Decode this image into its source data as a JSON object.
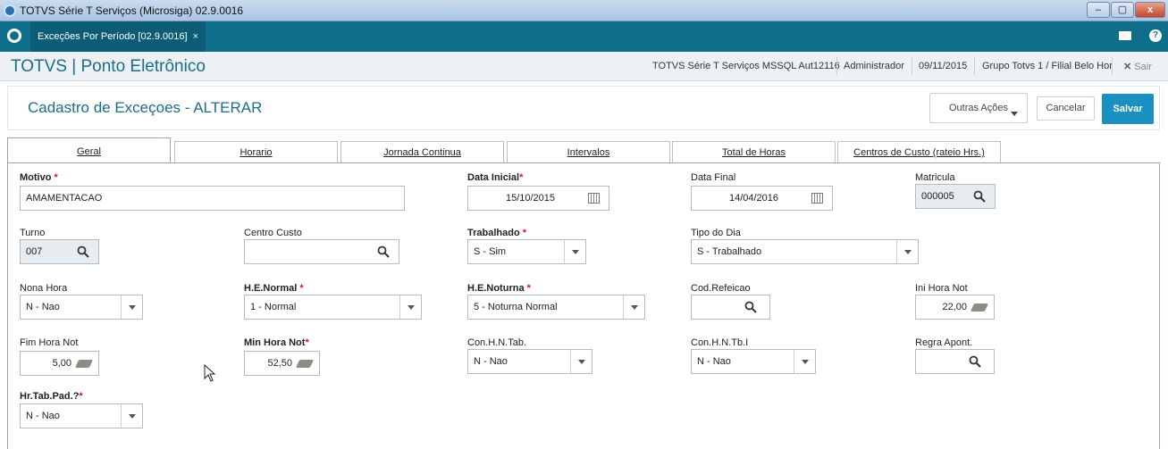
{
  "window": {
    "title": "TOTVS Série T Serviços (Microsiga) 02.9.0016"
  },
  "app_tab": {
    "label": "Exceções Por Período [02.9.0016]",
    "close": "×"
  },
  "header": {
    "module_title": "TOTVS | Ponto Eletrônico",
    "environment": "TOTVS Série T Serviços MSSQL Aut12116",
    "user": "Administrador",
    "date": "09/11/2015",
    "group": "Grupo Totvs 1 / Filial Belo Hor",
    "exit_label": "Sair"
  },
  "form": {
    "title": "Cadastro de Exceçoes - ALTERAR",
    "other_actions_label": "Outras Ações",
    "cancel_label": "Cancelar",
    "save_label": "Salvar"
  },
  "tabs": [
    {
      "label": "Geral"
    },
    {
      "label": "Horario"
    },
    {
      "label": "Jornada Continua"
    },
    {
      "label": "Intervalos"
    },
    {
      "label": "Total de Horas"
    },
    {
      "label": "Centros de Custo (rateio Hrs.)"
    }
  ],
  "fields": {
    "motivo": {
      "label": "Motivo",
      "value": "AMAMENTACAO"
    },
    "data_inicial": {
      "label": "Data Inicial",
      "value": "15/10/2015"
    },
    "data_final": {
      "label": "Data Final",
      "value": "14/04/2016"
    },
    "matricula": {
      "label": "Matricula",
      "value": "000005"
    },
    "turno": {
      "label": "Turno",
      "value": "007"
    },
    "centro_custo": {
      "label": "Centro Custo",
      "value": ""
    },
    "trabalhado": {
      "label": "Trabalhado",
      "value": "S - Sim"
    },
    "tipo_dia": {
      "label": "Tipo do Dia",
      "value": "S - Trabalhado"
    },
    "nona_hora": {
      "label": "Nona Hora",
      "value": "N - Nao"
    },
    "he_normal": {
      "label": "H.E.Normal",
      "value": "1 - Normal"
    },
    "he_noturna": {
      "label": "H.E.Noturna",
      "value": "5 - Noturna Normal"
    },
    "cod_refeicao": {
      "label": "Cod.Refeicao",
      "value": ""
    },
    "ini_hora_not": {
      "label": "Ini Hora Not",
      "value": "22,00"
    },
    "fim_hora_not": {
      "label": "Fim Hora Not",
      "value": "5,00"
    },
    "min_hora_not": {
      "label": "Min Hora Not",
      "value": "52,50"
    },
    "con_hn_tab": {
      "label": "Con.H.N.Tab.",
      "value": "N - Nao"
    },
    "con_hn_tbi": {
      "label": "Con.H.N.Tb.I",
      "value": "N - Nao"
    },
    "regra_apont": {
      "label": "Regra Apont.",
      "value": ""
    },
    "hr_tab_pad": {
      "label": "Hr.Tab.Pad.?",
      "value": "N - Nao"
    }
  },
  "required_mark": "*",
  "colors": {
    "accent": "#1b6c8b",
    "appbar": "#0f6f8a",
    "save": "#1a8fc2",
    "required": "#dd1122"
  }
}
